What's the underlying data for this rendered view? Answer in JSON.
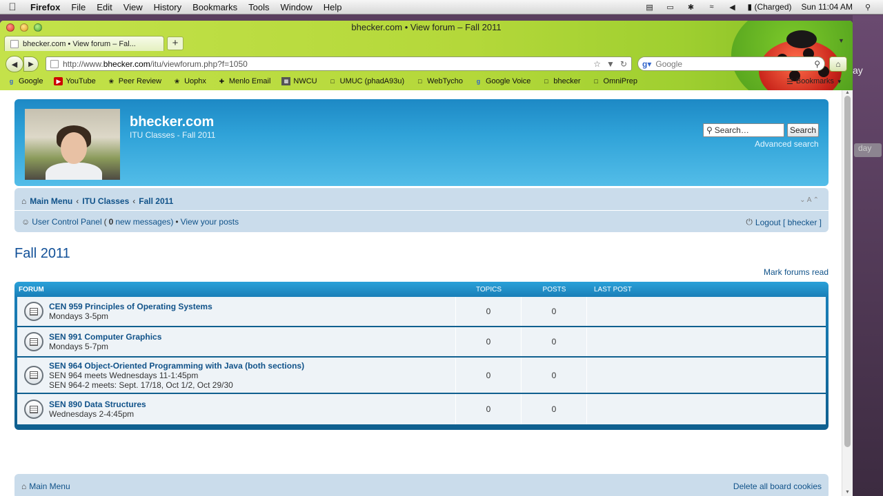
{
  "os_menubar": {
    "app": "Firefox",
    "menus": [
      "File",
      "Edit",
      "View",
      "History",
      "Bookmarks",
      "Tools",
      "Window",
      "Help"
    ],
    "battery": "(Charged)",
    "clock": "Sun 11:04 AM"
  },
  "desktop": {
    "partial_text": "ay",
    "badge": "day"
  },
  "browser": {
    "window_title": "bhecker.com • View forum – Fall 2011",
    "tab_title": "bhecker.com • View forum – Fal...",
    "new_tab": "+",
    "url_prefix": "http://www.",
    "url_host": "bhecker.com",
    "url_path": "/itu/viewforum.php?f=1050",
    "search_placeholder": "Google",
    "bookmarks": [
      {
        "label": "Google",
        "icon": "google-icon"
      },
      {
        "label": "YouTube",
        "icon": "youtube-icon"
      },
      {
        "label": "Peer Review",
        "icon": "phoenix-icon"
      },
      {
        "label": "Uophx",
        "icon": "phoenix-icon"
      },
      {
        "label": "Menlo Email",
        "icon": "menlo-icon"
      },
      {
        "label": "NWCU",
        "icon": "nwcu-icon"
      },
      {
        "label": "UMUC (phadA93u)",
        "icon": "page-icon"
      },
      {
        "label": "WebTycho",
        "icon": "page-icon"
      },
      {
        "label": "Google Voice",
        "icon": "google-icon"
      },
      {
        "label": "bhecker",
        "icon": "page-icon"
      },
      {
        "label": "OmniPrep",
        "icon": "page-icon"
      }
    ],
    "bookmarks_menu": "Bookmarks"
  },
  "site": {
    "title": "bhecker.com",
    "description": "ITU Classes - Fall 2011",
    "search_placeholder": "Search…",
    "search_button": "Search",
    "advanced_search": "Advanced search"
  },
  "navbar": {
    "crumbs": [
      "Main Menu",
      "ITU Classes",
      "Fall 2011"
    ],
    "ucp_label": "User Control Panel",
    "ucp_open": "(",
    "new_messages_count": "0",
    "new_messages_text": "new messages)",
    "bullet": "•",
    "view_posts": "View your posts",
    "logout": "Logout [ bhecker ]"
  },
  "page": {
    "title": "Fall 2011",
    "mark_read": "Mark forums read"
  },
  "forum_table": {
    "columns": [
      "FORUM",
      "TOPICS",
      "POSTS",
      "LAST POST"
    ],
    "rows": [
      {
        "title": "CEN 959 Principles of Operating Systems",
        "desc": [
          "Mondays 3-5pm"
        ],
        "topics": "0",
        "posts": "0"
      },
      {
        "title": "SEN 991 Computer Graphics",
        "desc": [
          "Mondays 5-7pm"
        ],
        "topics": "0",
        "posts": "0"
      },
      {
        "title": "SEN 964 Object-Oriented Programming with Java (both sections)",
        "desc": [
          "SEN 964 meets Wednesdays 11-1:45pm",
          "SEN 964-2 meets: Sept. 17/18, Oct 1/2, Oct 29/30"
        ],
        "topics": "0",
        "posts": "0"
      },
      {
        "title": "SEN 890 Data Structures",
        "desc": [
          "Wednesdays 2-4:45pm"
        ],
        "topics": "0",
        "posts": "0"
      }
    ]
  },
  "footer": {
    "main_menu": "Main Menu",
    "delete_cookies": "Delete all board cookies"
  },
  "colors": {
    "link": "#105289",
    "header_blue": "#2fa2d8",
    "nav_bg": "#cadceb",
    "toolbar_green": "#b4d83a"
  }
}
